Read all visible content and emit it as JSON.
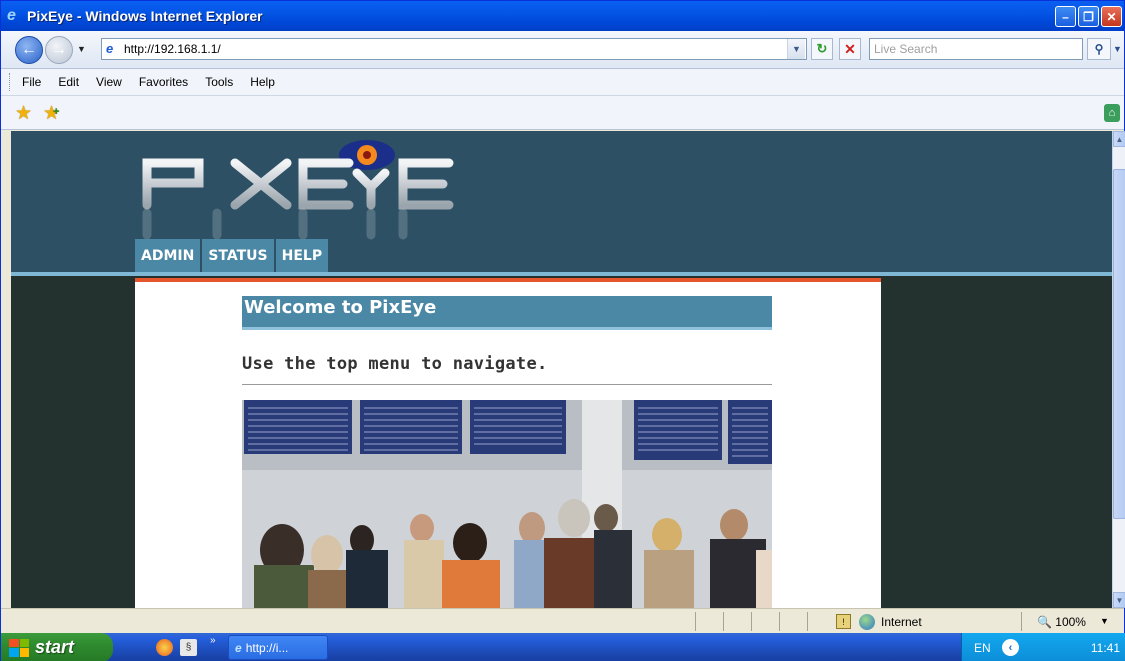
{
  "window": {
    "title": "PixEye - Windows Internet Explorer",
    "controls": [
      "minimize",
      "maximize",
      "close"
    ]
  },
  "address_bar": {
    "url": "http://192.168.1.1/",
    "search_placeholder": "Live Search"
  },
  "menu": {
    "items": [
      "File",
      "Edit",
      "View",
      "Favorites",
      "Tools",
      "Help"
    ]
  },
  "site": {
    "logo_text": "PIXEYE",
    "nav": [
      "ADMIN",
      "STATUS",
      "HELP"
    ],
    "welcome": "Welcome to PixEye",
    "instruction": "Use the top menu to navigate."
  },
  "status_bar": {
    "zone": "Internet",
    "zoom": "100%"
  },
  "taskbar": {
    "start": "start",
    "task_item": "http://i...",
    "language": "EN",
    "clock": "11:41"
  },
  "colors": {
    "header_bg": "#2d5065",
    "nav_tab": "#4a88a6",
    "accent_bar": "#e4572e",
    "page_bg": "#23312f"
  }
}
